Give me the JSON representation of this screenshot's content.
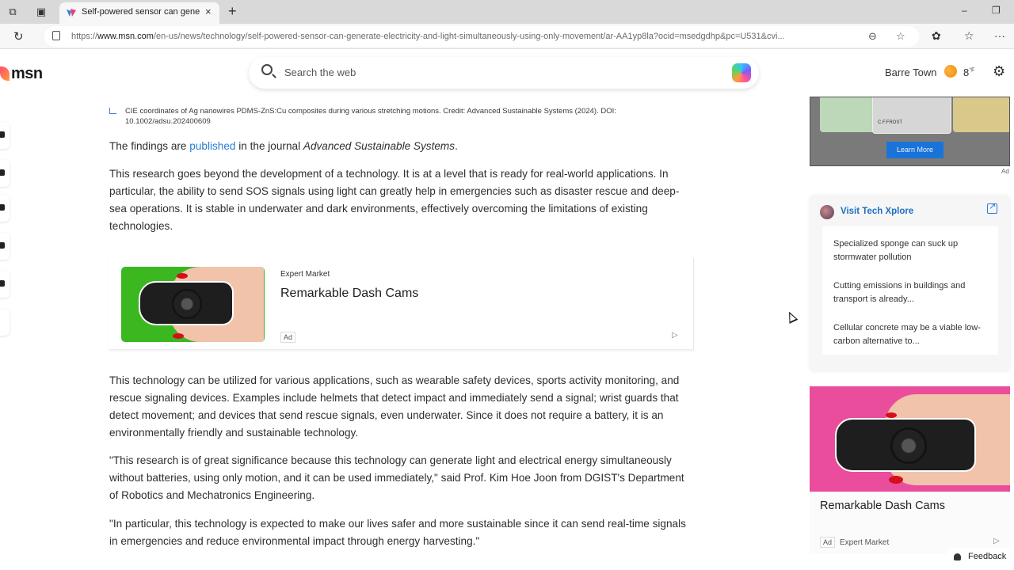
{
  "browser": {
    "tab_title": "Self-powered sensor can generate electricity and light simultaneously",
    "tab_close": "×",
    "new_tab": "+",
    "minimize": "–",
    "restore": "❐",
    "url_prefix": "https://",
    "url_domain": "www.msn.com",
    "url_path": "/en-us/news/technology/self-powered-sensor-can-generate-electricity-and-light-simultaneously-using-only-movement/ar-AA1yp8la?ocid=msedgdhp&pc=U531&cvi...",
    "icons": [
      "workspaces-icon",
      "tab-actions-icon",
      "reload-icon",
      "site-info-icon",
      "reader-icon",
      "favorite-star-icon",
      "extensions-icon",
      "favorites-icon",
      "more-icon"
    ]
  },
  "header": {
    "logo_text": "msn",
    "search_placeholder": "Search the web",
    "location": "Barre Town",
    "temperature": "8",
    "temp_unit": "°F"
  },
  "article": {
    "caption": "CIE coordinates of Ag nanowires PDMS-ZnS:Cu composites during various stretching motions. Credit: Advanced Sustainable Systems (2024). DOI: 10.1002/adsu.202400609",
    "p1_before": "The findings are ",
    "p1_link": "published",
    "p1_mid": " in the journal ",
    "p1_journal": "Advanced Sustainable Systems",
    "p1_end": ".",
    "p2": "This research goes beyond the development of a technology. It is at a level that is ready for real-world applications. In particular, the ability to send SOS signals using light can greatly help in emergencies such as disaster rescue and deep-sea operations. It is stable in underwater and dark environments, effectively overcoming the limitations of existing technologies.",
    "p3": "This technology can be utilized for various applications, such as wearable safety devices, sports activity monitoring, and rescue signaling devices. Examples include helmets that detect impact and immediately send a signal; wrist guards that detect movement; and devices that send rescue signals, even underwater. Since it does not require a battery, it is an environmentally friendly and sustainable technology.",
    "p4": "\"This research is of great significance because this technology can generate light and electrical energy simultaneously without batteries, using only motion, and it can be used immediately,\" said Prof. Kim Hoe Joon from DGIST's Department of Robotics and Mechatronics Engineering.",
    "p5": "\"In particular, this technology is expected to make our lives safer and more sustainable since it can send real-time signals in emergencies and reduce environmental impact through energy harvesting.\""
  },
  "inline_ad": {
    "source": "Expert Market",
    "title": "Remarkable Dash Cams",
    "badge": "Ad",
    "play": "▷"
  },
  "right_ad_top": {
    "button": "Learn More",
    "card_name": "C.F.FROST",
    "label": "Ad"
  },
  "widget": {
    "title": "Visit Tech Xplore",
    "items": [
      "Specialized sponge can suck up stormwater pollution",
      "Cutting emissions in buildings and transport is already...",
      "Cellular concrete may be a viable low-carbon alternative to..."
    ]
  },
  "right_ad_bottom": {
    "title": "Remarkable Dash Cams",
    "badge": "Ad",
    "source": "Expert Market",
    "play": "▷"
  },
  "feedback": "Feedback"
}
